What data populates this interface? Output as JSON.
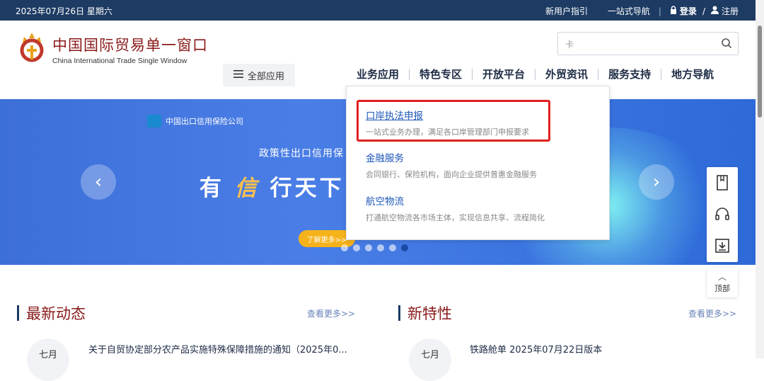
{
  "topbar": {
    "date": "2025年07月26日 星期六",
    "new_user_guide": "新用户指引",
    "one_stop_nav": "一站式导航",
    "login": "登录",
    "slash": "/",
    "register": "注册"
  },
  "logo": {
    "cn": "中国国际贸易单一窗口",
    "en": "China International Trade Single Window"
  },
  "all_apps": "全部应用",
  "search": {
    "value": "卡"
  },
  "nav": [
    "业务应用",
    "特色专区",
    "开放平台",
    "外贸资讯",
    "服务支持",
    "地方导航"
  ],
  "dropdown": [
    {
      "title": "口岸执法申报",
      "desc": "一站式业务办理，满足各口岸管理部门申报要求"
    },
    {
      "title": "金融服务",
      "desc": "会同银行、保险机构，面向企业提供普惠金融服务"
    },
    {
      "title": "航空物流",
      "desc": "打通航空物流各市场主体，实现信息共享、流程简化"
    }
  ],
  "banner": {
    "company": "中国出口信用保险公司",
    "slogan1": "政策性出口信用保",
    "slogan2_a": "有",
    "slogan2_b": "信",
    "slogan2_c": "行天下",
    "more": "了解更多>>",
    "dots": 6,
    "active_dot": 5
  },
  "sidebar": {
    "to_top": "顶部"
  },
  "sections": [
    {
      "heading": "最新动态",
      "more": "查看更多>>",
      "month": "七月",
      "item": "关于自贸协定部分农产品实施特殊保障措施的通知（2025年0..."
    },
    {
      "heading": "新特性",
      "more": "查看更多>>",
      "month": "七月",
      "item": "铁路舱单 2025年07月22日版本"
    }
  ],
  "colors": {
    "topbar": "#1d3b63",
    "accent_red": "#8a1a1a",
    "link_blue": "#1c57b8",
    "highlight": "#e02020"
  }
}
